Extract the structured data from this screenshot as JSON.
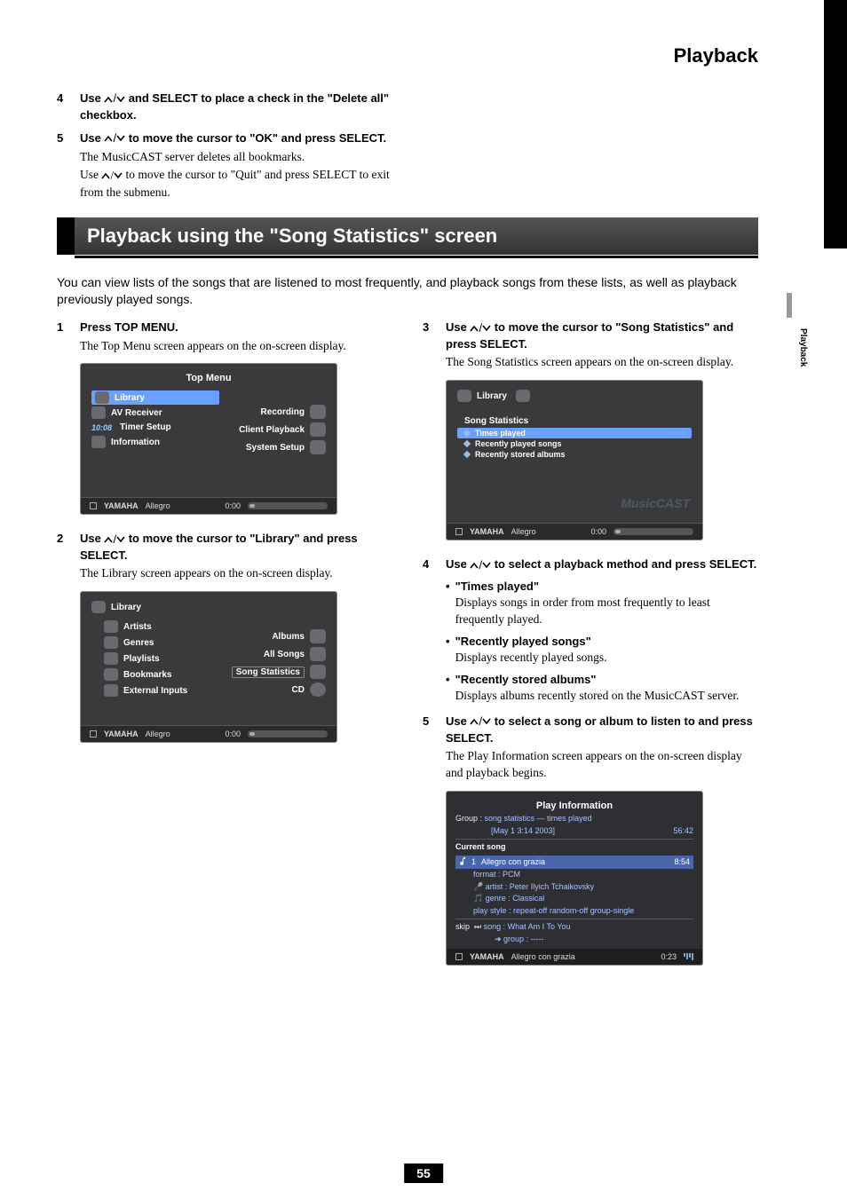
{
  "header": {
    "title": "Playback",
    "sideLabel": "Playback",
    "pageNumber": "55"
  },
  "pre": {
    "s4": {
      "n": "4",
      "line1a": "Use ",
      "line1b": " and SELECT to place a check in the \"Delete all\" checkbox."
    },
    "s5": {
      "n": "5",
      "line1a": "Use ",
      "line1b": " to move the cursor to \"OK\" and press SELECT.",
      "p1": "The MusicCAST server deletes all bookmarks.",
      "p2a": "Use ",
      "p2b": " to move the cursor to \"Quit\" and press SELECT to exit from the submenu."
    }
  },
  "section": {
    "title": "Playback using the \"Song Statistics\" screen"
  },
  "intro": "You can view lists of the songs that are listened to most frequently, and playback songs from these lists, as well as playback previously played songs.",
  "left": {
    "s1": {
      "n": "1",
      "h": "Press TOP MENU.",
      "p": "The Top Menu screen appears on the on-screen display."
    },
    "s2": {
      "n": "2",
      "ha": "Use ",
      "hb": " to move the cursor to \"Library\" and press SELECT.",
      "p": "The Library screen appears on the on-screen display."
    }
  },
  "right": {
    "s3": {
      "n": "3",
      "ha": "Use ",
      "hb": " to move the cursor to \"Song Statistics\" and press SELECT.",
      "p": "The Song Statistics screen appears on the on-screen display."
    },
    "s4": {
      "n": "4",
      "ha": "Use ",
      "hb": " to select a playback method and press SELECT.",
      "b1": {
        "h": "\"Times played\"",
        "p": "Displays songs in order from most frequently to least frequently played."
      },
      "b2": {
        "h": "\"Recently played songs\"",
        "p": "Displays recently played songs."
      },
      "b3": {
        "h": "\"Recently stored albums\"",
        "p": "Displays albums recently stored on the MusicCAST server."
      }
    },
    "s5": {
      "n": "5",
      "ha": "Use ",
      "hb": " to select a song or album to listen to and press SELECT.",
      "p": "The Play Information screen appears on the on-screen display and playback begins."
    }
  },
  "shot1": {
    "title": "Top Menu",
    "l1": "Library",
    "l2": "AV Receiver",
    "l3": "Timer Setup",
    "l4": "Information",
    "r1": "Recording",
    "r2": "Client Playback",
    "r3": "System Setup",
    "time": "10:08",
    "status": {
      "brand": "YAMAHA",
      "track": "Allegro",
      "time": "0:00"
    }
  },
  "shot2": {
    "head": "Library",
    "l1": "Artists",
    "l2": "Genres",
    "l3": "Playlists",
    "l4": "Bookmarks",
    "l5": "External Inputs",
    "r1": "Albums",
    "r2": "All Songs",
    "r3": "Song Statistics",
    "r4": "CD",
    "status": {
      "brand": "YAMAHA",
      "track": "Allegro",
      "time": "0:00"
    }
  },
  "shot3": {
    "head": "Library",
    "sub": "Song Statistics",
    "i1": "Times played",
    "i2": "Recently played songs",
    "i3": "Recently stored albums",
    "wm": "MusicCAST",
    "status": {
      "brand": "YAMAHA",
      "track": "Allegro",
      "time": "0:00"
    }
  },
  "shot4": {
    "title": "Play Information",
    "groupLabel": "Group :",
    "group": "song statistics — times played",
    "date": "[May  1  3:14 2003]",
    "total": "56:42",
    "currentLabel": "Current song",
    "songNo": "1",
    "songName": "Allegro con grazia",
    "songTime": "8:54",
    "format": "format : PCM",
    "artist": "artist : Peter Ilyich Tchaikovsky",
    "genre": "genre : Classical",
    "pstyle": "play style : repeat-off     random-off     group-single",
    "skipLabel": "skip",
    "skipSong": "song : What Am I To You",
    "skipGroup": "group : -----",
    "status": {
      "brand": "YAMAHA",
      "track": "Allegro con grazia",
      "time": "0:23"
    }
  }
}
